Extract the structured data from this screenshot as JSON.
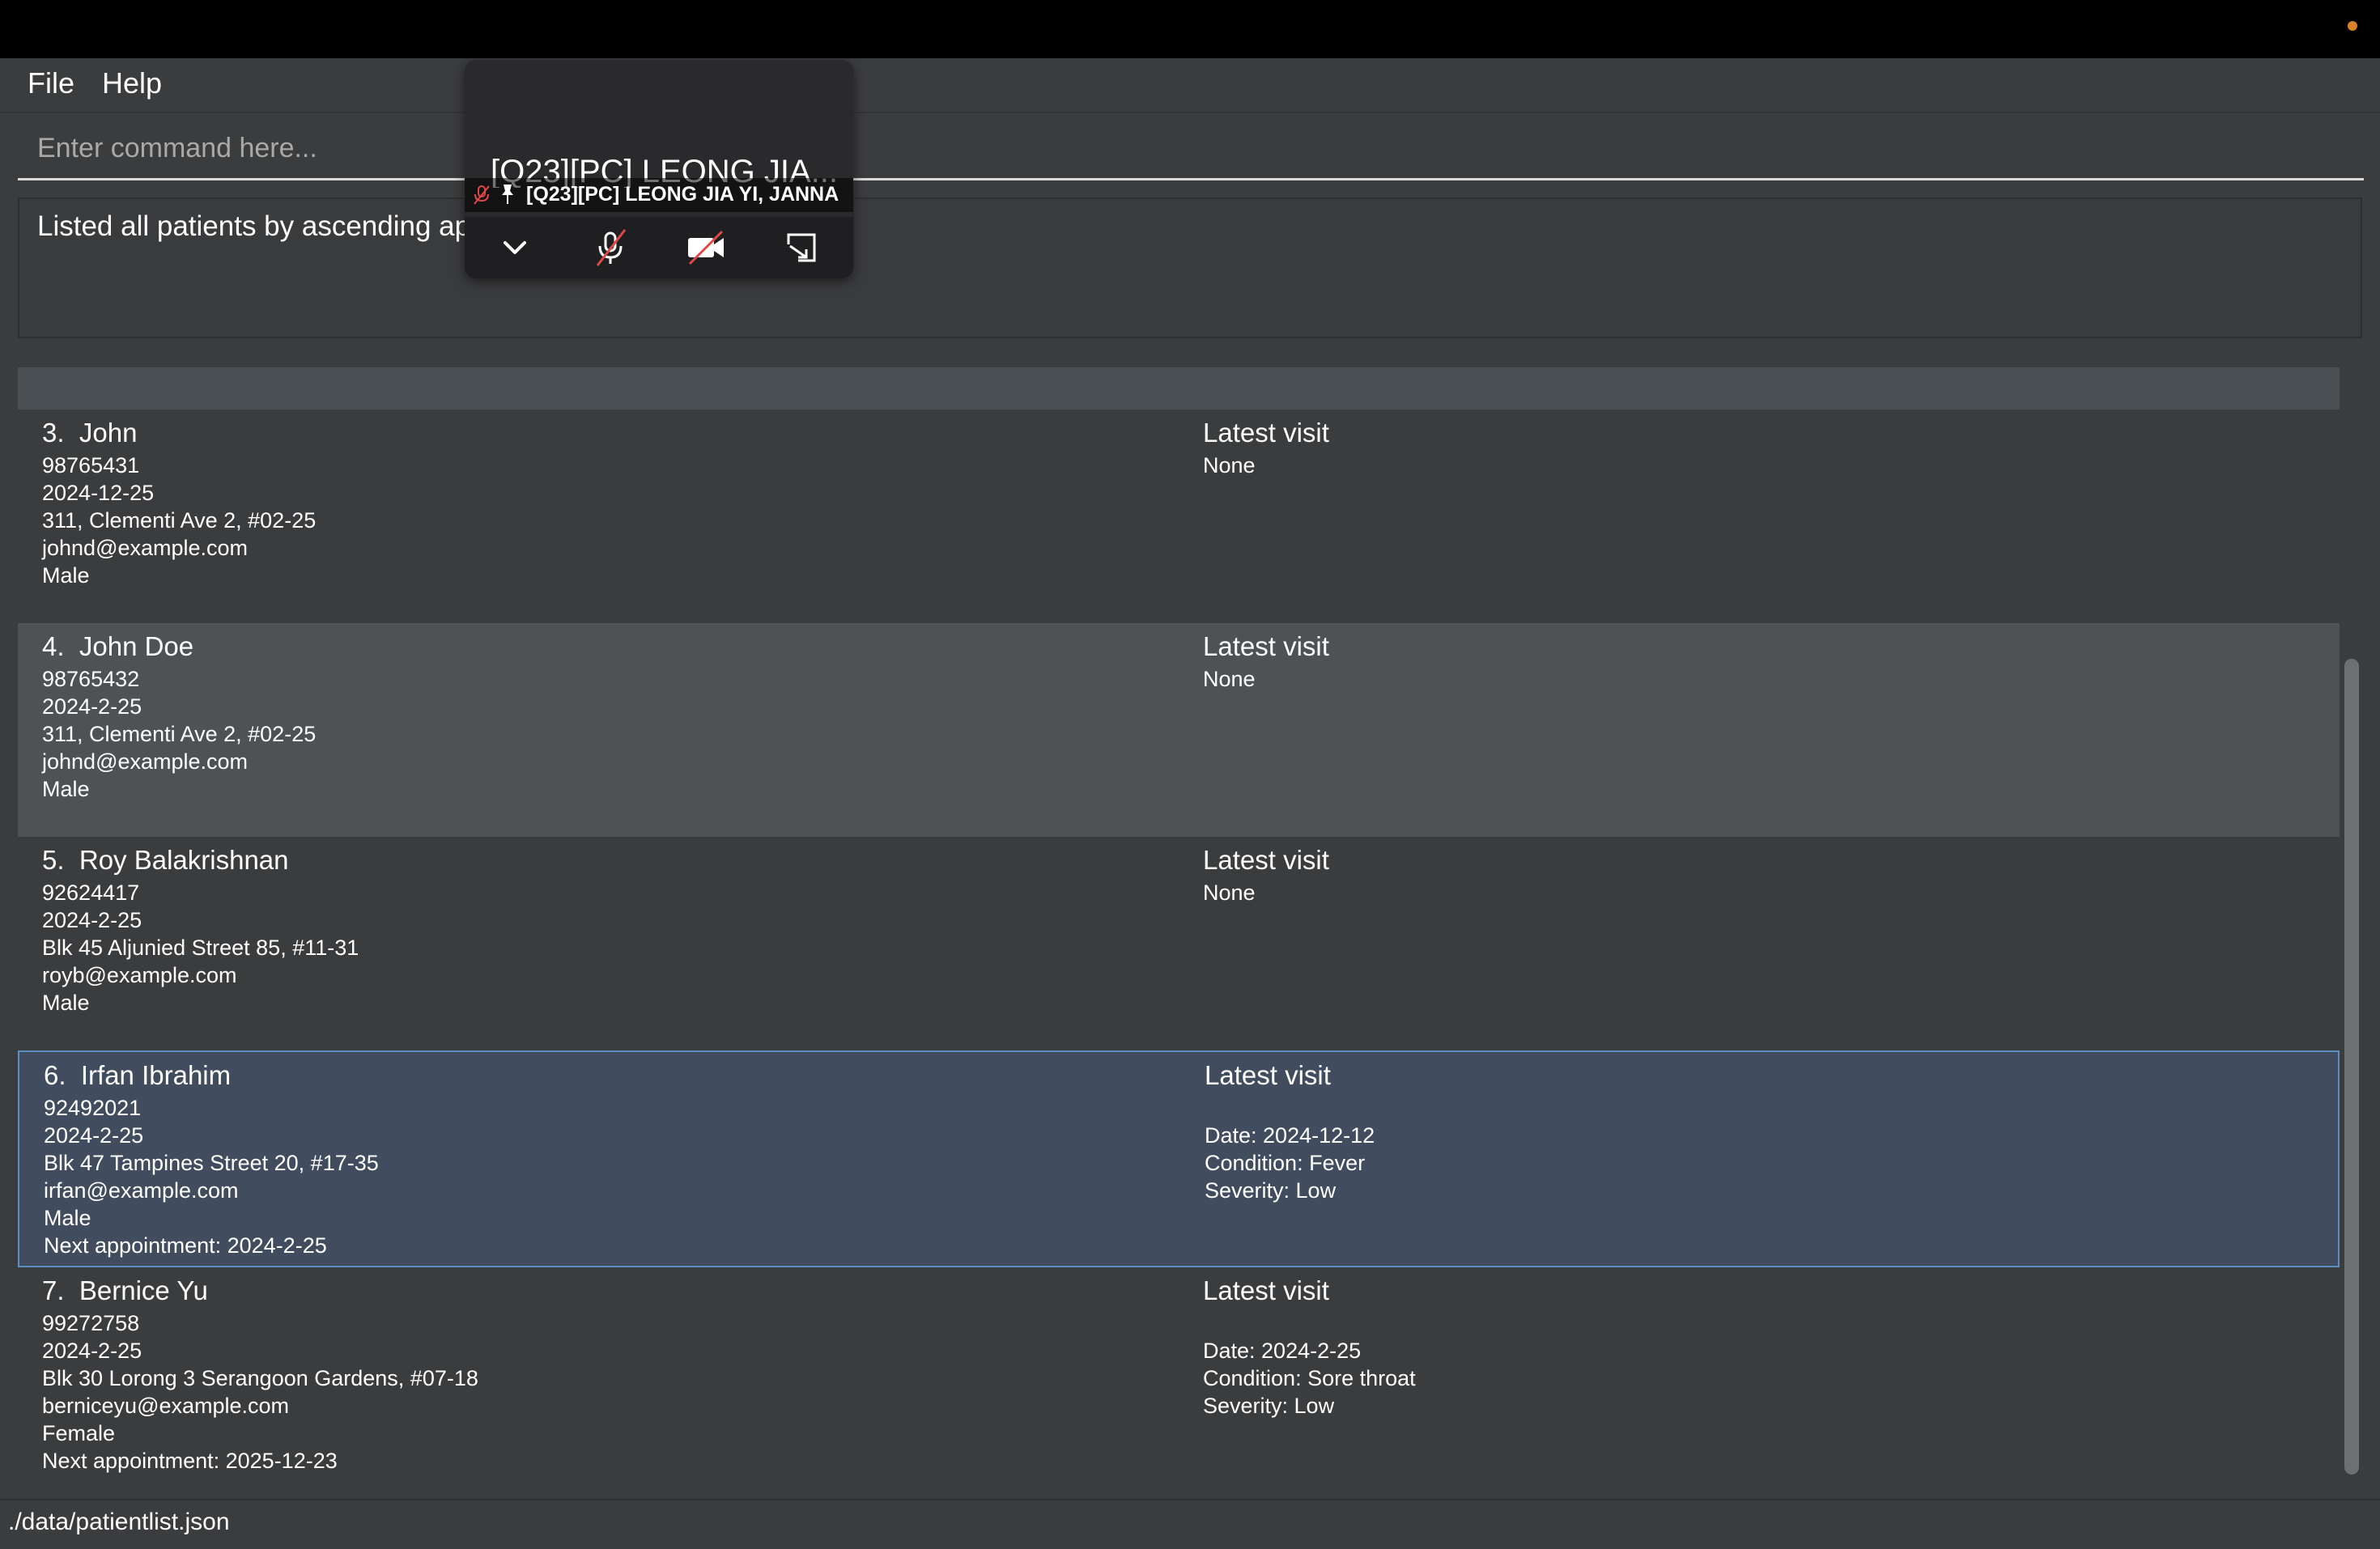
{
  "menu": {
    "file": "File",
    "help": "Help"
  },
  "command": {
    "placeholder": "Enter command here..."
  },
  "result": {
    "text": "Listed all patients by ascending appo"
  },
  "patients": [
    {
      "index": "3.",
      "name": "John",
      "phone": "98765431",
      "date": "2024-12-25",
      "address": "311, Clementi Ave 2, #02-25",
      "email": "johnd@example.com",
      "gender": "Male",
      "visit_title": "Latest visit",
      "visit": "None"
    },
    {
      "index": "4.",
      "name": "John Doe",
      "phone": "98765432",
      "date": "2024-2-25",
      "address": "311, Clementi Ave 2, #02-25",
      "email": "johnd@example.com",
      "gender": "Male",
      "visit_title": "Latest visit",
      "visit": "None"
    },
    {
      "index": "5.",
      "name": "Roy Balakrishnan",
      "phone": "92624417",
      "date": "2024-2-25",
      "address": "Blk 45 Aljunied Street 85, #11-31",
      "email": "royb@example.com",
      "gender": "Male",
      "visit_title": "Latest visit",
      "visit": "None"
    },
    {
      "index": "6.",
      "name": "Irfan Ibrahim",
      "phone": "92492021",
      "date": "2024-2-25",
      "address": "Blk 47 Tampines Street 20, #17-35",
      "email": "irfan@example.com",
      "gender": "Male",
      "appointment": "Next appointment: 2024-2-25",
      "visit_title": "Latest visit",
      "visit_date": "Date: 2024-12-12",
      "visit_condition": "Condition: Fever",
      "visit_severity": "Severity: Low"
    },
    {
      "index": "7.",
      "name": "Bernice Yu",
      "phone": "99272758",
      "date": "2024-2-25",
      "address": "Blk 30 Lorong 3 Serangoon Gardens, #07-18",
      "email": "berniceyu@example.com",
      "gender": "Female",
      "appointment": "Next appointment: 2025-12-23",
      "visit_title": "Latest visit",
      "visit_date": "Date: 2024-2-25",
      "visit_condition": "Condition: Sore throat",
      "visit_severity": "Severity: Low"
    }
  ],
  "status": {
    "path": "./data/patientlist.json"
  },
  "overlay": {
    "title": "[Q23][PC] LEONG JIA...",
    "subtitle": "[Q23][PC] LEONG JIA YI, JANNA"
  },
  "icons": {
    "mic_muted": "mic-off-icon",
    "pin": "pin-icon",
    "collapse": "chevron-down-icon",
    "mic": "mic-off-icon",
    "camera": "camera-off-icon",
    "expand": "expand-icon"
  },
  "colors": {
    "accent": "#5b8fc4",
    "selected_bg": "#414d5f",
    "status_dot": "#d9822b"
  }
}
